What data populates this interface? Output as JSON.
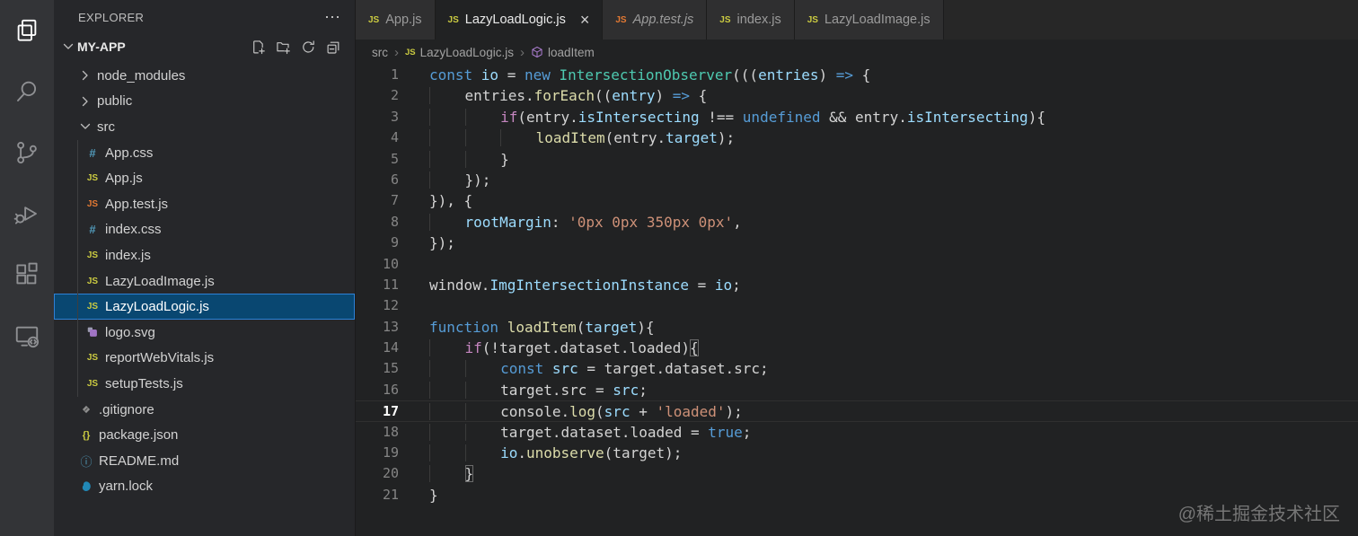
{
  "activity_bar": {
    "items": [
      {
        "name": "explorer",
        "active": true
      },
      {
        "name": "search",
        "active": false
      },
      {
        "name": "source-control",
        "active": false
      },
      {
        "name": "run-and-debug",
        "active": false
      },
      {
        "name": "extensions",
        "active": false
      },
      {
        "name": "remote-explorer",
        "active": false
      }
    ]
  },
  "explorer": {
    "title": "EXPLORER",
    "more_label": "⋯",
    "project": "MY-APP",
    "toolbar": [
      "new-file",
      "new-folder",
      "refresh",
      "collapse-all"
    ],
    "tree": [
      {
        "label": "node_modules",
        "kind": "folder",
        "expanded": false,
        "level": 0
      },
      {
        "label": "public",
        "kind": "folder",
        "expanded": false,
        "level": 0
      },
      {
        "label": "src",
        "kind": "folder",
        "expanded": true,
        "level": 0
      },
      {
        "label": "App.css",
        "kind": "file",
        "icon": "css",
        "level": 1
      },
      {
        "label": "App.js",
        "kind": "file",
        "icon": "js",
        "level": 1
      },
      {
        "label": "App.test.js",
        "kind": "file",
        "icon": "js-test",
        "level": 1
      },
      {
        "label": "index.css",
        "kind": "file",
        "icon": "css",
        "level": 1
      },
      {
        "label": "index.js",
        "kind": "file",
        "icon": "js",
        "level": 1
      },
      {
        "label": "LazyLoadImage.js",
        "kind": "file",
        "icon": "js",
        "level": 1
      },
      {
        "label": "LazyLoadLogic.js",
        "kind": "file",
        "icon": "js",
        "level": 1,
        "selected": true
      },
      {
        "label": "logo.svg",
        "kind": "file",
        "icon": "svg",
        "level": 1
      },
      {
        "label": "reportWebVitals.js",
        "kind": "file",
        "icon": "js",
        "level": 1
      },
      {
        "label": "setupTests.js",
        "kind": "file",
        "icon": "js",
        "level": 1
      },
      {
        "label": ".gitignore",
        "kind": "file",
        "icon": "git",
        "level": 0
      },
      {
        "label": "package.json",
        "kind": "file",
        "icon": "json",
        "level": 0
      },
      {
        "label": "README.md",
        "kind": "file",
        "icon": "readme",
        "level": 0
      },
      {
        "label": "yarn.lock",
        "kind": "file",
        "icon": "yarn",
        "level": 0
      }
    ]
  },
  "tabs": [
    {
      "label": "App.js",
      "icon": "js",
      "active": false,
      "italic": false
    },
    {
      "label": "LazyLoadLogic.js",
      "icon": "js",
      "active": true,
      "italic": false,
      "close": "×"
    },
    {
      "label": "App.test.js",
      "icon": "js-test",
      "active": false,
      "italic": true
    },
    {
      "label": "index.js",
      "icon": "js",
      "active": false,
      "italic": false
    },
    {
      "label": "LazyLoadImage.js",
      "icon": "js",
      "active": false,
      "italic": false
    }
  ],
  "breadcrumb": [
    {
      "label": "src"
    },
    {
      "label": "LazyLoadLogic.js",
      "icon": "js"
    },
    {
      "label": "loadItem",
      "icon": "symbol-method"
    }
  ],
  "editor": {
    "current_line": 17,
    "lines": [
      {
        "n": 1,
        "indent": 0,
        "tokens": [
          [
            "k",
            "const "
          ],
          [
            "v",
            "io"
          ],
          [
            "d",
            " = "
          ],
          [
            "k",
            "new "
          ],
          [
            "t",
            "IntersectionObserver"
          ],
          [
            "d",
            "((("
          ],
          [
            "v",
            "entries"
          ],
          [
            "d",
            ") "
          ],
          [
            "k",
            "=>"
          ],
          [
            "d",
            " {"
          ]
        ]
      },
      {
        "n": 2,
        "indent": 1,
        "tokens": [
          [
            "d",
            "entries."
          ],
          [
            "f",
            "forEach"
          ],
          [
            "d",
            "(("
          ],
          [
            "v",
            "entry"
          ],
          [
            "d",
            ") "
          ],
          [
            "k",
            "=>"
          ],
          [
            "d",
            " {"
          ]
        ]
      },
      {
        "n": 3,
        "indent": 2,
        "tokens": [
          [
            "c",
            "if"
          ],
          [
            "d",
            "(entry."
          ],
          [
            "v",
            "isIntersecting"
          ],
          [
            "d",
            " !== "
          ],
          [
            "k",
            "undefined"
          ],
          [
            "d",
            " && entry."
          ],
          [
            "v",
            "isIntersecting"
          ],
          [
            "d",
            "){"
          ]
        ]
      },
      {
        "n": 4,
        "indent": 3,
        "tokens": [
          [
            "f",
            "loadItem"
          ],
          [
            "d",
            "(entry."
          ],
          [
            "v",
            "target"
          ],
          [
            "d",
            ");"
          ]
        ]
      },
      {
        "n": 5,
        "indent": 2,
        "tokens": [
          [
            "d",
            "}"
          ]
        ]
      },
      {
        "n": 6,
        "indent": 1,
        "tokens": [
          [
            "d",
            "});"
          ]
        ]
      },
      {
        "n": 7,
        "indent": 0,
        "tokens": [
          [
            "d",
            "}), {"
          ]
        ]
      },
      {
        "n": 8,
        "indent": 1,
        "tokens": [
          [
            "v",
            "rootMargin"
          ],
          [
            "d",
            ": "
          ],
          [
            "s",
            "'0px 0px 350px 0px'"
          ],
          [
            "d",
            ","
          ]
        ]
      },
      {
        "n": 9,
        "indent": 0,
        "tokens": [
          [
            "d",
            "});"
          ]
        ]
      },
      {
        "n": 10,
        "indent": 0,
        "tokens": []
      },
      {
        "n": 11,
        "indent": 0,
        "tokens": [
          [
            "d",
            "window."
          ],
          [
            "v",
            "ImgIntersectionInstance"
          ],
          [
            "d",
            " = "
          ],
          [
            "v",
            "io"
          ],
          [
            "d",
            ";"
          ]
        ]
      },
      {
        "n": 12,
        "indent": 0,
        "tokens": []
      },
      {
        "n": 13,
        "indent": 0,
        "tokens": [
          [
            "k",
            "function "
          ],
          [
            "f",
            "loadItem"
          ],
          [
            "d",
            "("
          ],
          [
            "v",
            "target"
          ],
          [
            "d",
            "){"
          ]
        ]
      },
      {
        "n": 14,
        "indent": 1,
        "tokens": [
          [
            "c",
            "if"
          ],
          [
            "d",
            "(!target.dataset.loaded)"
          ],
          [
            "bx",
            "{"
          ]
        ]
      },
      {
        "n": 15,
        "indent": 2,
        "tokens": [
          [
            "k",
            "const "
          ],
          [
            "v",
            "src"
          ],
          [
            "d",
            " = target.dataset.src;"
          ]
        ]
      },
      {
        "n": 16,
        "indent": 2,
        "tokens": [
          [
            "d",
            "target.src = "
          ],
          [
            "v",
            "src"
          ],
          [
            "d",
            ";"
          ]
        ]
      },
      {
        "n": 17,
        "indent": 2,
        "current": true,
        "tokens": [
          [
            "d",
            "console."
          ],
          [
            "f",
            "log"
          ],
          [
            "d",
            "("
          ],
          [
            "v",
            "src"
          ],
          [
            "d",
            " + "
          ],
          [
            "s",
            "'loaded'"
          ],
          [
            "d",
            ");"
          ]
        ]
      },
      {
        "n": 18,
        "indent": 2,
        "tokens": [
          [
            "d",
            "target.dataset.loaded = "
          ],
          [
            "k",
            "true"
          ],
          [
            "d",
            ";"
          ]
        ]
      },
      {
        "n": 19,
        "indent": 2,
        "tokens": [
          [
            "v",
            "io"
          ],
          [
            "d",
            "."
          ],
          [
            "f",
            "unobserve"
          ],
          [
            "d",
            "(target);"
          ]
        ]
      },
      {
        "n": 20,
        "indent": 1,
        "tokens": [
          [
            "bx",
            "}"
          ]
        ]
      },
      {
        "n": 21,
        "indent": 0,
        "tokens": [
          [
            "d",
            "}"
          ]
        ]
      }
    ]
  },
  "watermark": "@稀土掘金技术社区",
  "colors": {
    "activity_bar_bg": "#333437",
    "sidebar_bg": "#26272a",
    "editor_bg": "#212223",
    "tab_inactive_bg": "#2f2f30",
    "tabbar_bg": "#272727",
    "selection_bg": "#094771",
    "selection_border": "#2e81d6",
    "js_icon": "#cbcb41",
    "js_test_icon": "#e37933",
    "css_icon": "#519aba",
    "svg_icon": "#a074c4",
    "yarn_icon": "#2188b6",
    "keyword": "#569cd6",
    "control": "#c586c0",
    "class_name": "#4ec9b0",
    "function_name": "#dcdcaa",
    "variable": "#9cdcfe",
    "string": "#ce9178",
    "default_text": "#d4d4d4"
  }
}
